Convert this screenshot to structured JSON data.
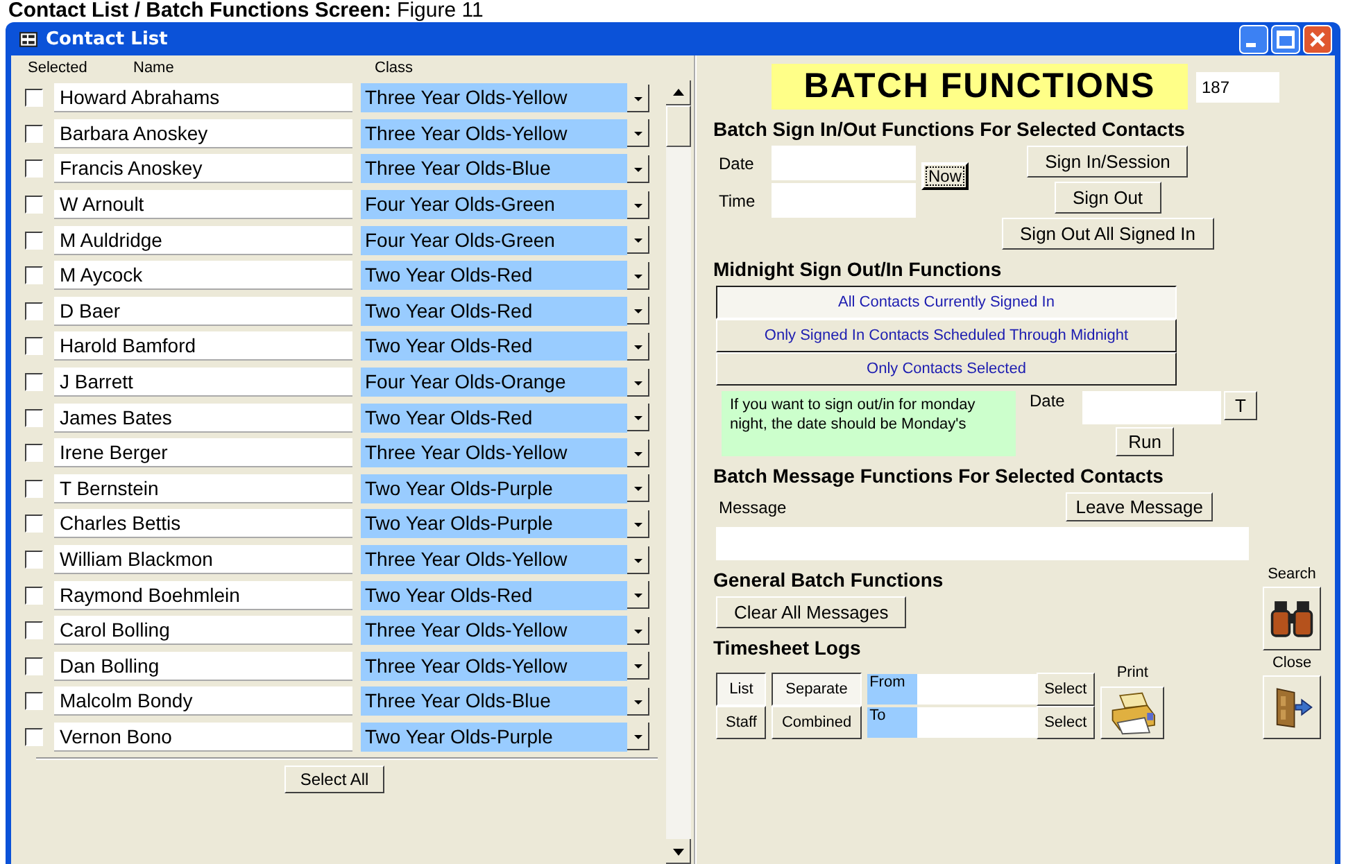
{
  "caption": "**Contact List / Batch Functions Screen:** Figure 11",
  "window": {
    "title": "Contact List"
  },
  "contacts": {
    "columns": [
      "Selected",
      "Name",
      "Class"
    ],
    "rows": [
      {
        "checked": false,
        "name": "Howard Abrahams",
        "class": "Three Year Olds-Yellow"
      },
      {
        "checked": false,
        "name": "Barbara Anoskey",
        "class": "Three Year Olds-Yellow"
      },
      {
        "checked": false,
        "name": "Francis Anoskey",
        "class": "Three Year Olds-Blue"
      },
      {
        "checked": false,
        "name": "W Arnoult",
        "class": "Four Year Olds-Green"
      },
      {
        "checked": false,
        "name": "M Auldridge",
        "class": "Four Year Olds-Green"
      },
      {
        "checked": false,
        "name": "M Aycock",
        "class": "Two Year Olds-Red"
      },
      {
        "checked": false,
        "name": "D Baer",
        "class": "Two Year Olds-Red"
      },
      {
        "checked": false,
        "name": "Harold Bamford",
        "class": "Two Year Olds-Red"
      },
      {
        "checked": false,
        "name": "J Barrett",
        "class": "Four Year Olds-Orange"
      },
      {
        "checked": false,
        "name": "James Bates",
        "class": "Two Year Olds-Red"
      },
      {
        "checked": false,
        "name": "Irene Berger",
        "class": "Three Year Olds-Yellow"
      },
      {
        "checked": false,
        "name": "T Bernstein",
        "class": "Two Year Olds-Purple"
      },
      {
        "checked": false,
        "name": "Charles Bettis",
        "class": "Two Year Olds-Purple"
      },
      {
        "checked": false,
        "name": "William Blackmon",
        "class": "Three Year Olds-Yellow"
      },
      {
        "checked": false,
        "name": "Raymond Boehmlein",
        "class": "Two Year Olds-Red"
      },
      {
        "checked": false,
        "name": "Carol Bolling",
        "class": "Three Year Olds-Yellow"
      },
      {
        "checked": false,
        "name": "Dan Bolling",
        "class": "Three Year Olds-Yellow"
      },
      {
        "checked": false,
        "name": "Malcolm Bondy",
        "class": "Three Year Olds-Blue"
      },
      {
        "checked": false,
        "name": "Vernon Bono",
        "class": "Two Year Olds-Purple"
      }
    ],
    "select_all": "Select All"
  },
  "batch": {
    "title": "BATCH FUNCTIONS",
    "count": "187",
    "sign": {
      "heading": "Batch Sign In/Out Functions For Selected Contacts",
      "date_label": "Date",
      "time_label": "Time",
      "now": "Now",
      "buttons": [
        "Sign In/Session",
        "Sign Out",
        "Sign Out All Signed In"
      ]
    },
    "midnight": {
      "heading": "Midnight Sign Out/In Functions",
      "options": [
        {
          "label": "All Contacts Currently Signed In",
          "selected": true
        },
        {
          "label": "Only Signed In Contacts Scheduled Through Midnight",
          "selected": false
        },
        {
          "label": "Only Contacts Selected",
          "selected": false
        }
      ],
      "note": "If you want to sign out/in for monday night, the date should be Monday's",
      "date_label": "Date",
      "today": "T",
      "run": "Run"
    },
    "message": {
      "heading": "Batch Message Functions For Selected Contacts",
      "label": "Message",
      "button": "Leave Message"
    },
    "general": {
      "heading": "General Batch Functions",
      "button": "Clear All Messages"
    },
    "timesheet": {
      "heading": "Timesheet Logs",
      "view": [
        {
          "label": "List",
          "selected": true
        },
        {
          "label": "Staff",
          "selected": false
        }
      ],
      "mode": [
        {
          "label": "Separate",
          "selected": true
        },
        {
          "label": "Combined",
          "selected": false
        }
      ],
      "from": "From",
      "to": "To",
      "select": [
        "Select",
        "Select"
      ],
      "print": "Print"
    },
    "search": "Search",
    "close": "Close"
  }
}
